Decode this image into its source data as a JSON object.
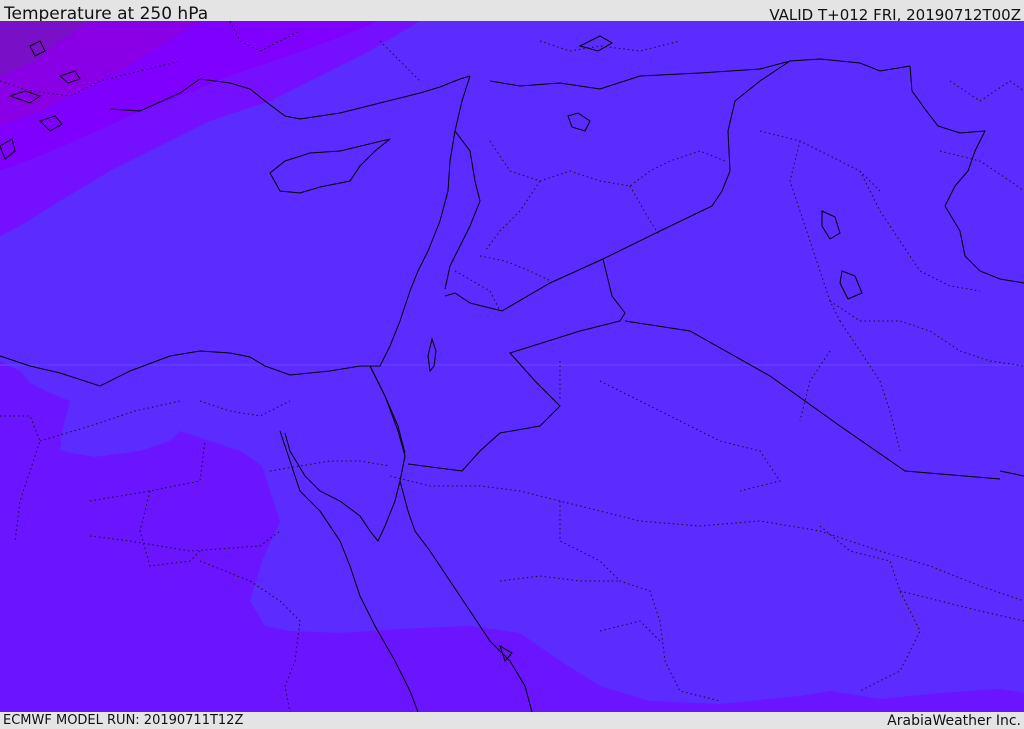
{
  "header": {
    "title": "Temperature at 250 hPa",
    "valid": "VALID T+012 FRI, 20190712T00Z"
  },
  "footer": {
    "model_run": "ECMWF MODEL RUN: 20190711T12Z",
    "credit": "ArabiaWeather Inc."
  },
  "map": {
    "fill_colors": {
      "base": "#5b2bff",
      "warm_south": "#6a14ff",
      "cold_north": "#8000ff",
      "coldest_north": "#8a00e6",
      "darkest_corner": "#7a0fc8"
    },
    "border_color": "#000000"
  }
}
